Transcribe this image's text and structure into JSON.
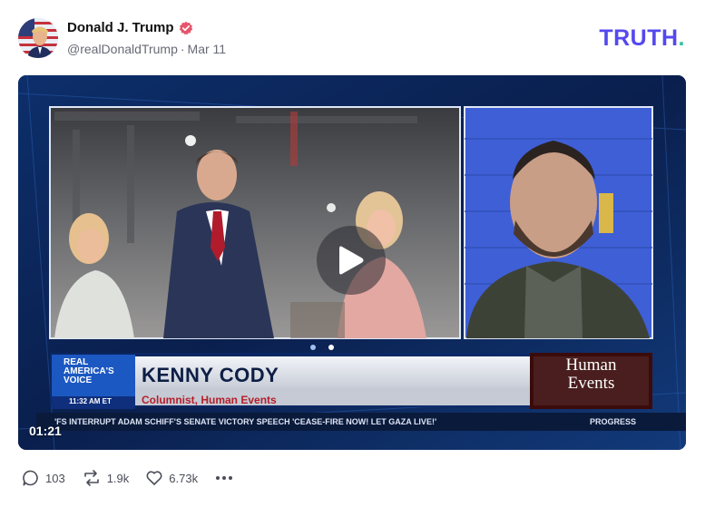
{
  "post": {
    "author_name": "Donald J. Trump",
    "handle": "@realDonaldTrump",
    "date": "Mar 11"
  },
  "brand": {
    "logo_text": "TRUTH",
    "logo_period": ".",
    "colors": {
      "logo": "#5448ee",
      "logo_period": "#32c2a1",
      "verified": "#e5556a"
    }
  },
  "video": {
    "duration": "01:21",
    "lower_third": {
      "channel_badge_line1": "REAL",
      "channel_badge_line2": "AMERICA'S",
      "channel_badge_line3": "VOICE",
      "clock": "11:32 AM ET",
      "name": "KENNY CODY",
      "title": "Columnist, Human Events",
      "outlet_logo_line1": "Human",
      "outlet_logo_line2": "Events",
      "ticker": "'FS INTERRUPT ADAM SCHIFF'S SENATE VICTORY SPEECH  'CEASE-FIRE NOW! LET GAZA LIVE!'",
      "ticker_right": "PROGRESS"
    }
  },
  "actions": {
    "replies": "103",
    "reposts": "1.9k",
    "likes": "6.73k"
  }
}
